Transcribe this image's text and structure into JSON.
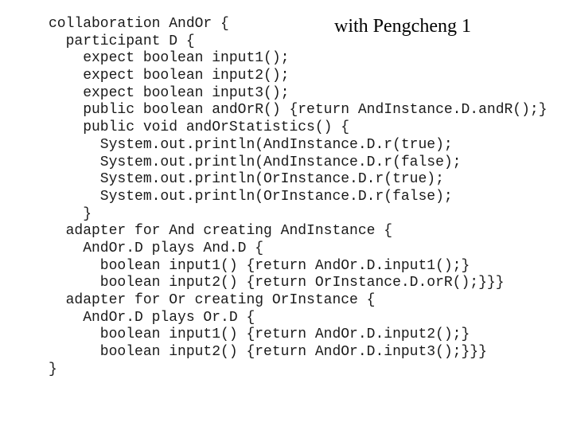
{
  "title": "with Pengcheng 1",
  "code_lines": [
    "collaboration AndOr {",
    "  participant D {",
    "    expect boolean input1();",
    "    expect boolean input2();",
    "    expect boolean input3();",
    "    public boolean andOrR() {return AndInstance.D.andR();}",
    "    public void andOrStatistics() {",
    "      System.out.println(AndInstance.D.r(true);",
    "      System.out.println(AndInstance.D.r(false);",
    "      System.out.println(OrInstance.D.r(true);",
    "      System.out.println(OrInstance.D.r(false);",
    "    }",
    "  adapter for And creating AndInstance {",
    "    AndOr.D plays And.D {",
    "      boolean input1() {return AndOr.D.input1();}",
    "      boolean input2() {return OrInstance.D.orR();}}}",
    "  adapter for Or creating OrInstance {",
    "    AndOr.D plays Or.D {",
    "      boolean input1() {return AndOr.D.input2();}",
    "      boolean input2() {return AndOr.D.input3();}}}",
    "}"
  ]
}
